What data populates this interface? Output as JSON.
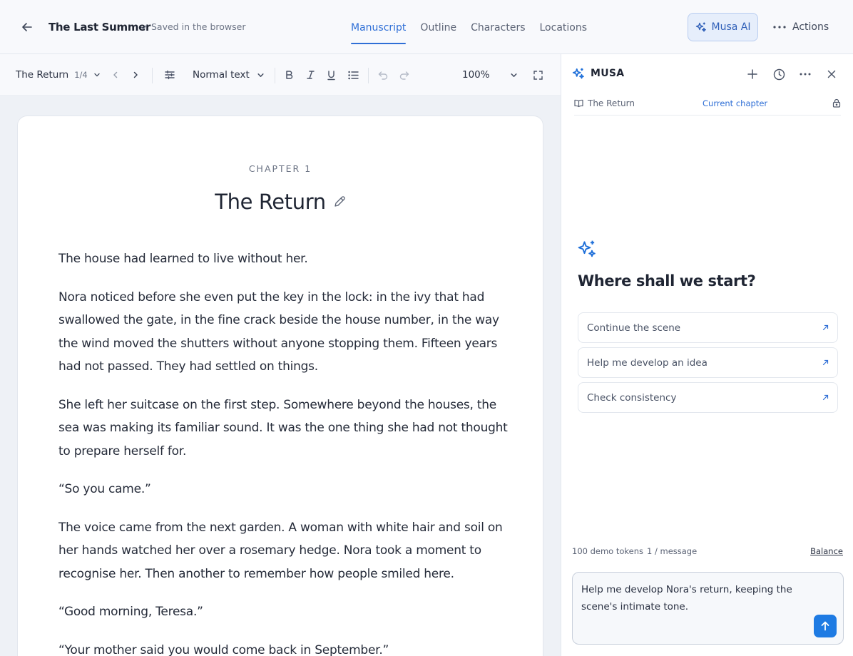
{
  "header": {
    "title": "The Last Summer",
    "saved_status": "Saved in the browser",
    "tabs": [
      {
        "label": "Manuscript",
        "active": true
      },
      {
        "label": "Outline",
        "active": false
      },
      {
        "label": "Characters",
        "active": false
      },
      {
        "label": "Locations",
        "active": false
      }
    ],
    "ai_button": "Musa AI",
    "actions_button": "Actions"
  },
  "toolbar": {
    "chapter_name": "The Return",
    "chapter_position": "1/4",
    "text_style": "Normal text",
    "zoom": "100%",
    "icons": [
      "chevron-down-icon",
      "chevron-left-icon",
      "chevron-right-icon",
      "sliders-icon",
      "bold-icon",
      "italic-icon",
      "underline-icon",
      "list-icon",
      "undo-icon",
      "redo-icon",
      "fullscreen-icon"
    ]
  },
  "document": {
    "chapter_label": "CHAPTER 1",
    "chapter_title": "The Return",
    "paragraphs": [
      "The house had learned to live without her.",
      "Nora noticed before she even put the key in the lock: in the ivy that had swallowed the gate, in the fine crack beside the house number, in the way the wind moved the shutters without anyone stopping them. Fifteen years had not passed. They had settled on things.",
      "She left her suitcase on the first step. Somewhere beyond the houses, the sea was making its familiar sound. It was the one thing she had not thought to prepare herself for.",
      "“So you came.”",
      "The voice came from the next garden. A woman with white hair and soil on her hands watched her over a rosemary hedge. Nora took a moment to recognise her. Then another to remember how people smiled here.",
      "“Good morning, Teresa.”",
      "“Your mother said you would come back in September.”"
    ]
  },
  "panel": {
    "brand": "MUSA",
    "context_chapter": "The Return",
    "context_scope": "Current chapter",
    "welcome_title": "Where shall we start?",
    "suggestions": [
      "Continue the scene",
      "Help me develop an idea",
      "Check consistency"
    ],
    "tokens": "100 demo tokens",
    "per_message": "1 / message",
    "balance": "Balance",
    "composer_value": "Help me develop Nora's return, keeping the scene's intimate tone."
  },
  "colors": {
    "accent": "#2f6fd6",
    "send_button": "#1e7be3",
    "ai_button_bg": "#e6eefb"
  }
}
